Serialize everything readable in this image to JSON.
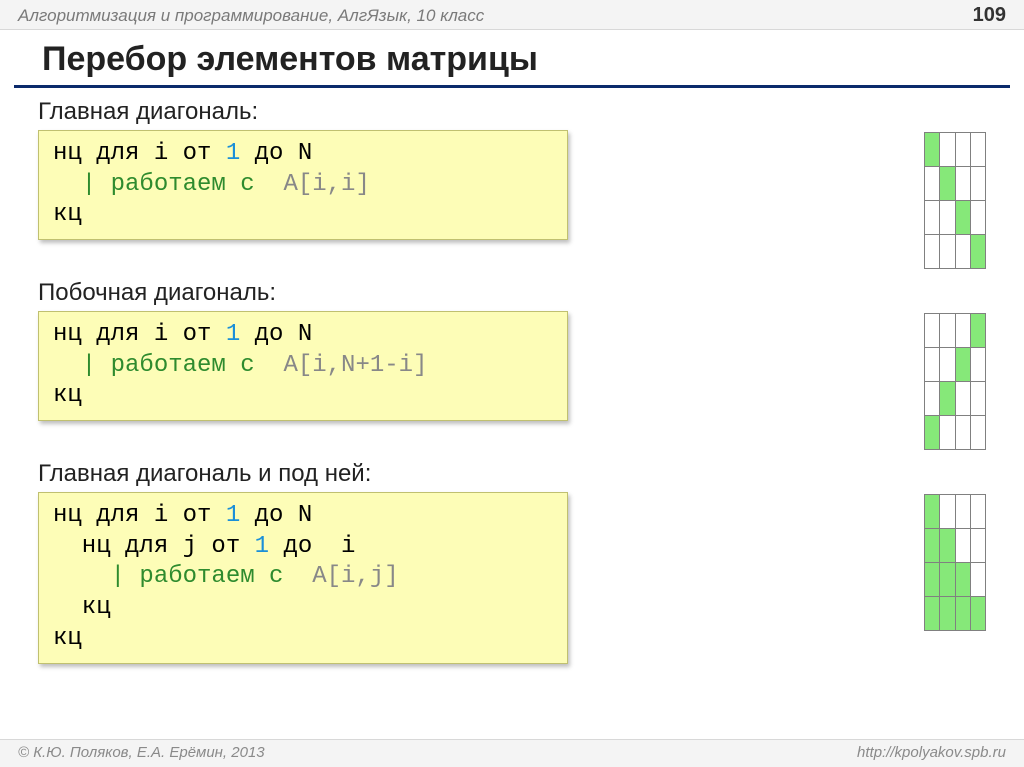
{
  "header": {
    "subject": "Алгоритмизация и программирование, АлгЯзык, 10 класс",
    "page_number": "109"
  },
  "title": "Перебор элементов матрицы",
  "sections": [
    {
      "label": "Главная диагональ:",
      "code": {
        "l1a": "нц для i от ",
        "l1b": "1",
        "l1c": " до N",
        "l2a": "  | работаем с  ",
        "l2b": "A[i,i]",
        "l3": "кц"
      },
      "matrix_type": "main"
    },
    {
      "label": "Побочная диагональ:",
      "code": {
        "l1a": "нц для i от ",
        "l1b": "1",
        "l1c": " до N",
        "l2a": "  | работаем с  ",
        "l2b": "A[i,N+1-i]",
        "l3": "кц"
      },
      "matrix_type": "anti"
    },
    {
      "label": "Главная диагональ и под ней:",
      "code": {
        "l1a": "нц для i от ",
        "l1b": "1",
        "l1c": " до N",
        "l2a": "  нц для j от ",
        "l2b": "1",
        "l2c": " до  i",
        "l3a": "    | работаем с  ",
        "l3b": "A[i,j]",
        "l4": "  кц",
        "l5": "кц"
      },
      "matrix_type": "lower"
    }
  ],
  "matrices": {
    "main": [
      [
        1,
        0,
        0,
        0
      ],
      [
        0,
        1,
        0,
        0
      ],
      [
        0,
        0,
        1,
        0
      ],
      [
        0,
        0,
        0,
        1
      ]
    ],
    "anti": [
      [
        0,
        0,
        0,
        1
      ],
      [
        0,
        0,
        1,
        0
      ],
      [
        0,
        1,
        0,
        0
      ],
      [
        1,
        0,
        0,
        0
      ]
    ],
    "lower": [
      [
        1,
        0,
        0,
        0
      ],
      [
        1,
        1,
        0,
        0
      ],
      [
        1,
        1,
        1,
        0
      ],
      [
        1,
        1,
        1,
        1
      ]
    ]
  },
  "footer": {
    "copyright": "© К.Ю. Поляков, Е.А. Ерёмин, 2013",
    "url": "http://kpolyakov.spb.ru"
  }
}
